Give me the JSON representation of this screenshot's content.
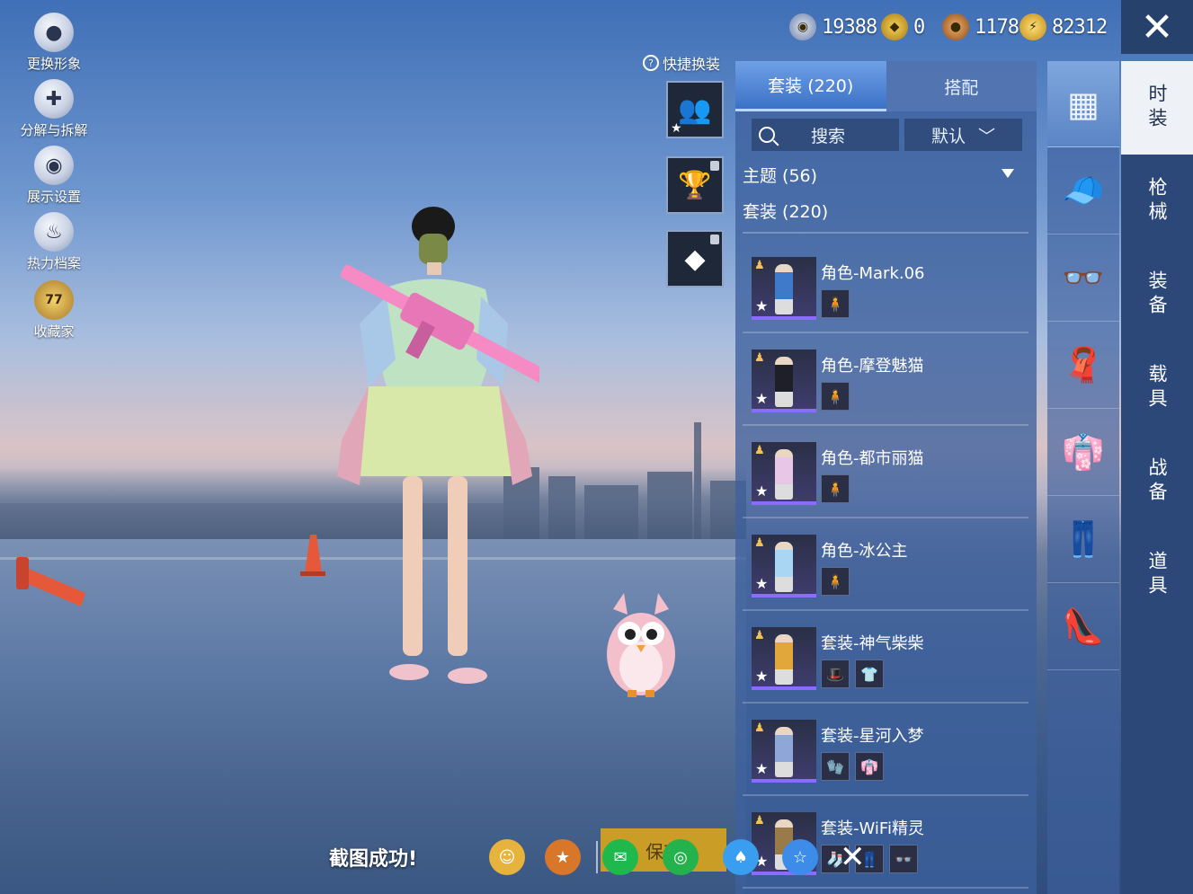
{
  "left_menu": [
    {
      "label": "更换形象",
      "icon": "person-icon"
    },
    {
      "label": "分解与拆解",
      "icon": "puzzle-icon"
    },
    {
      "label": "展示设置",
      "icon": "eye-icon"
    },
    {
      "label": "热力档案",
      "icon": "flame-icon"
    },
    {
      "label": "收藏家",
      "icon": "collector-badge-icon",
      "badge": "77"
    }
  ],
  "currency": [
    {
      "value": "19388",
      "icon": "silver-coin-icon",
      "color": "#8aa0c8"
    },
    {
      "value": "0",
      "icon": "gold-token-icon",
      "color": "#c79a1a"
    },
    {
      "value": "1178",
      "icon": "bronze-coin-icon",
      "color": "#b86a2a"
    },
    {
      "value": "82312",
      "icon": "lightning-coin-icon",
      "color": "#e5b52d"
    }
  ],
  "quick_change": {
    "label": "快捷换装",
    "help_icon": "?"
  },
  "tabs": [
    {
      "label": "套装 (220)",
      "active": true
    },
    {
      "label": "搭配",
      "active": false
    }
  ],
  "search": {
    "placeholder": "搜索"
  },
  "sort": {
    "label": "默认"
  },
  "filters": {
    "theme": "主题 (56)",
    "suits": "套装 (220)"
  },
  "items": [
    {
      "name": "角色-Mark.06",
      "color": "#3f7ac8",
      "minis": [
        "🧍"
      ]
    },
    {
      "name": "角色-摩登魅猫",
      "color": "#1f1f28",
      "minis": [
        "🧍"
      ]
    },
    {
      "name": "角色-都市丽猫",
      "color": "#e7c6e6",
      "minis": [
        "🧍"
      ]
    },
    {
      "name": "角色-冰公主",
      "color": "#a9d6f2",
      "minis": [
        "🧍"
      ]
    },
    {
      "name": "套装-神气柴柴",
      "color": "#e2a73a",
      "minis": [
        "🎩",
        "👕"
      ]
    },
    {
      "name": "套装-星河入梦",
      "color": "#8fa6d8",
      "minis": [
        "🧤",
        "👘"
      ]
    },
    {
      "name": "套装-WiFi精灵",
      "color": "#9b7a4a",
      "minis": [
        "🧦",
        "👖",
        "👓"
      ]
    }
  ],
  "categories": [
    {
      "icon": "outfit-box-icon",
      "glyph": "▦",
      "active": true
    },
    {
      "icon": "cap-icon",
      "glyph": "🧢"
    },
    {
      "icon": "glasses-icon",
      "glyph": "👓"
    },
    {
      "icon": "mask-icon",
      "glyph": "🧣"
    },
    {
      "icon": "top-clothes-icon",
      "glyph": "👘"
    },
    {
      "icon": "pants-icon",
      "glyph": "👖"
    },
    {
      "icon": "shoes-icon",
      "glyph": "👠"
    }
  ],
  "side_tabs": [
    {
      "label": "时装",
      "active": true
    },
    {
      "label": "枪械"
    },
    {
      "label": "装备"
    },
    {
      "label": "载具"
    },
    {
      "label": "战备"
    },
    {
      "label": "道具"
    }
  ],
  "bottom": {
    "toast": "截图成功!",
    "save_label": "保存",
    "share": [
      {
        "icon": "avatar-share-icon",
        "color": "#e6b33c"
      },
      {
        "icon": "game-logo-icon",
        "color": "#d8762a"
      },
      {
        "icon": "wechat-icon",
        "color": "#1fb84d"
      },
      {
        "icon": "moments-icon",
        "color": "#23b24c"
      },
      {
        "icon": "qq-icon",
        "color": "#3a9ef0"
      },
      {
        "icon": "qzone-icon",
        "color": "#3d8de8"
      }
    ]
  }
}
